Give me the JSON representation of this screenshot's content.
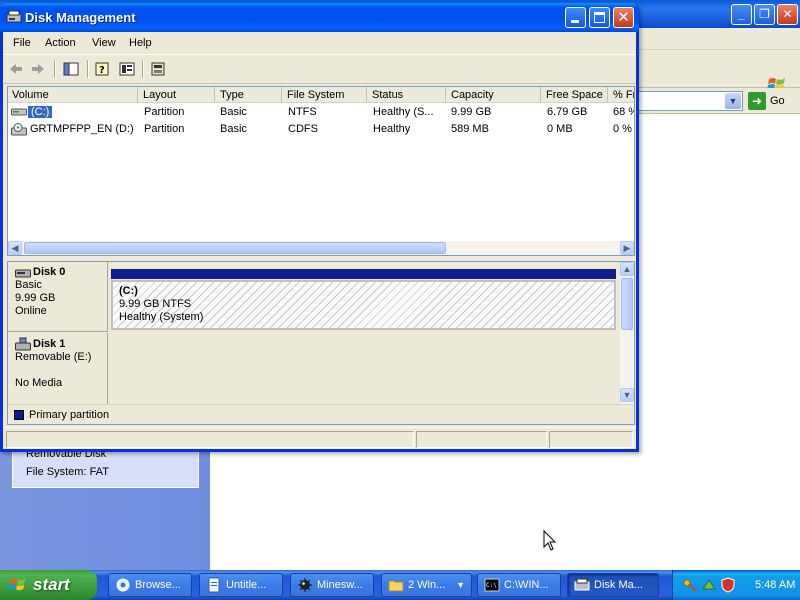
{
  "background_window": {
    "address_go_label": "Go",
    "details_panel": {
      "line1": "Removable Disk",
      "line2": "File System: FAT"
    }
  },
  "window": {
    "title": "Disk Management",
    "menu": [
      "File",
      "Action",
      "View",
      "Help"
    ]
  },
  "volume_list": {
    "columns": [
      "Volume",
      "Layout",
      "Type",
      "File System",
      "Status",
      "Capacity",
      "Free Space",
      "% Fr"
    ],
    "rows": [
      {
        "volume": "(C:)",
        "layout": "Partition",
        "type": "Basic",
        "file_system": "NTFS",
        "status": "Healthy (S...",
        "capacity": "9.99 GB",
        "free_space": "6.79 GB",
        "pct_free": "68 %",
        "icon": "hard-drive-icon",
        "selected": true
      },
      {
        "volume": "GRTMPFPP_EN (D:)",
        "layout": "Partition",
        "type": "Basic",
        "file_system": "CDFS",
        "status": "Healthy",
        "capacity": "589 MB",
        "free_space": "0 MB",
        "pct_free": "0 %",
        "icon": "cd-drive-icon",
        "selected": false
      }
    ]
  },
  "disks": [
    {
      "name": "Disk 0",
      "type": "Basic",
      "size": "9.99 GB",
      "state": "Online",
      "partition": {
        "name": "(C:)",
        "size_fs": "9.99 GB NTFS",
        "status": "Healthy (System)"
      }
    },
    {
      "name": "Disk 1",
      "type": "Removable (E:)",
      "size": "",
      "state": "No Media"
    }
  ],
  "legend": {
    "primary_partition": "Primary partition",
    "primary_color": "#0f1d8c"
  },
  "taskbar": {
    "start_label": "start",
    "buttons": [
      "Browse...",
      "Untitle...",
      "Minesw...",
      "2 Win...",
      "C:\\WIN...",
      "Disk Ma..."
    ],
    "clock": "5:48 AM"
  },
  "colors": {
    "title_blue": "#0053ee",
    "selection_blue": "#316ac5",
    "start_green": "#3a9e3a"
  }
}
